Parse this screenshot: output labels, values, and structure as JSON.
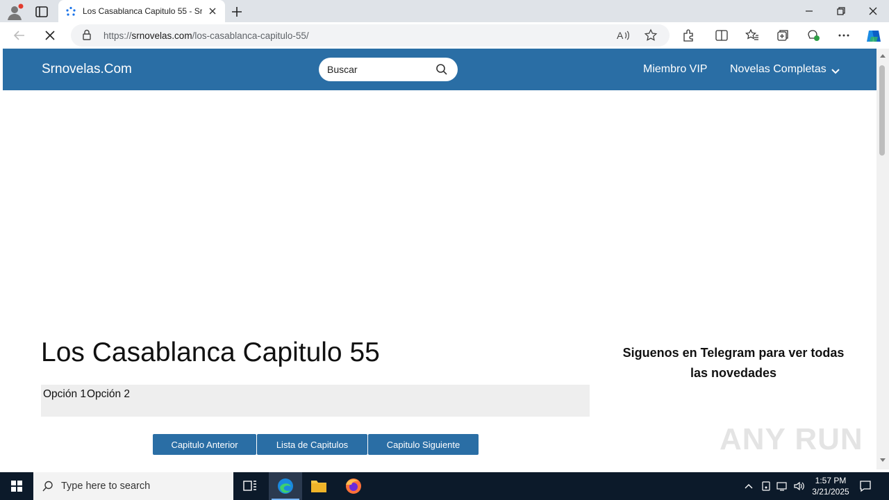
{
  "browser": {
    "tab_title": "Los Casablanca Capitulo 55 - Srnovelas",
    "url_prefix": "https://",
    "url_domain": "srnovelas.com",
    "url_path": "/los-casablanca-capitulo-55/"
  },
  "site": {
    "logo": "Srnovelas.Com",
    "search_placeholder": "Buscar",
    "nav": {
      "vip": "Miembro VIP",
      "completas": "Novelas Completas"
    },
    "page_title": "Los Casablanca Capitulo 55",
    "options": [
      "Opción 1",
      "Opción 2"
    ],
    "buttons": {
      "prev": "Capitulo Anterior",
      "list": "Lista de Capitulos",
      "next": "Capitulo Siguiente"
    },
    "telegram": "Siguenos en Telegram para ver todas las novedades",
    "accent_color": "#2a6ea5"
  },
  "watermark": "ANY RUN",
  "taskbar": {
    "search_placeholder": "Type here to search",
    "time": "1:57 PM",
    "date": "3/21/2025"
  }
}
